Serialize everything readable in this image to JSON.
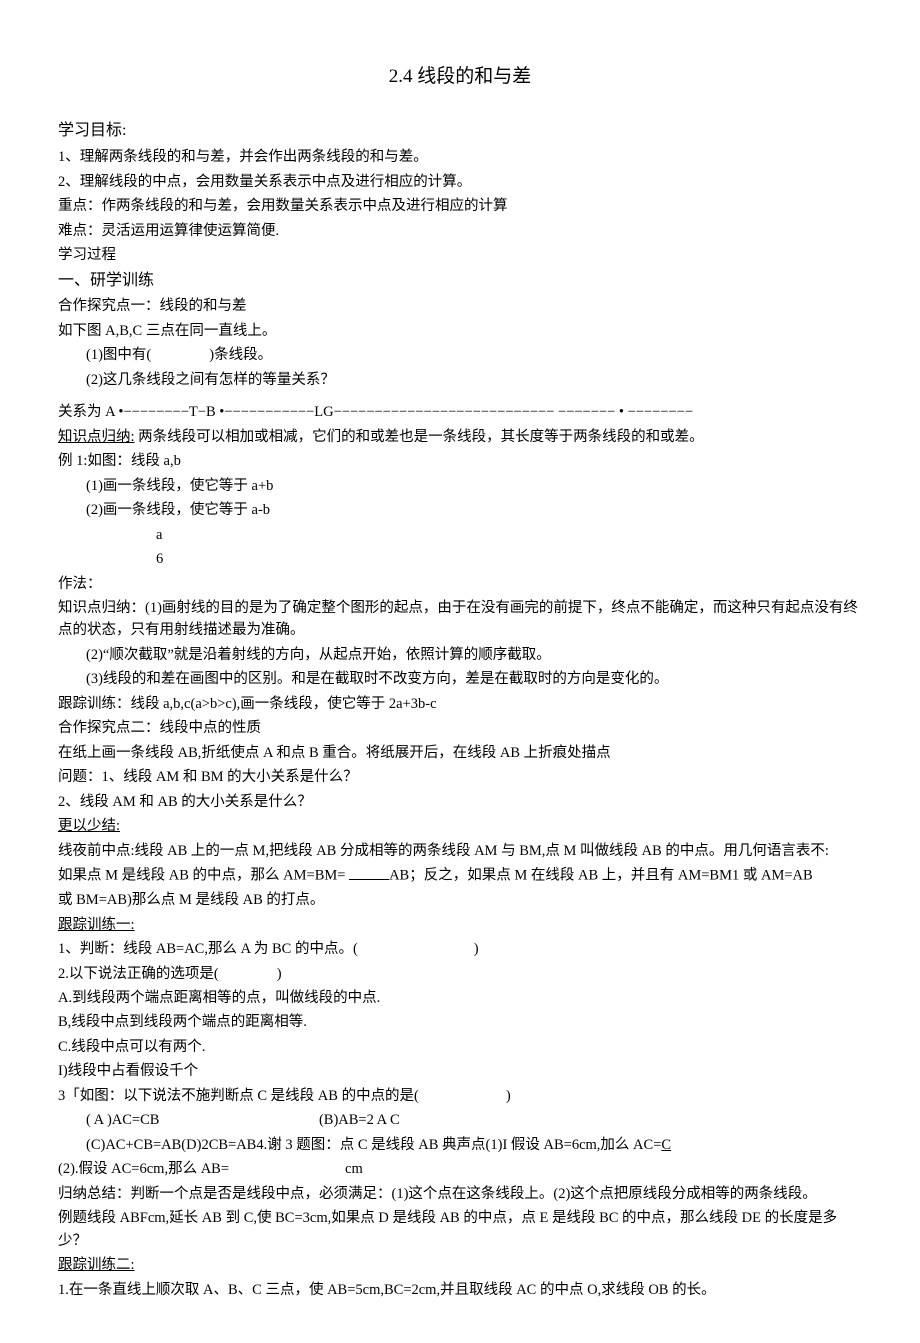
{
  "title": "2.4 线段的和与差",
  "h_goal": "学习目标:",
  "goal1": "1、理解两条线段的和与差，并会作出两条线段的和与差。",
  "goal2": "2、理解线段的中点，会用数量关系表示中点及进行相应的计算。",
  "keypoint": "重点：作两条线段的和与差，会用数量关系表示中点及进行相应的计算",
  "diffpoint": "难点：灵活运用运算律使运算简便.",
  "process": "学习过程",
  "sec1": "一、研学训练",
  "coop1": "合作探究点一：线段的和与差",
  "fig_intro": "如下图 A,B,C 三点在同一直线上。",
  "q1": "(1)图中有(　　　　)条线段。",
  "q2": "(2)这几条线段之间有怎样的等量关系？",
  "relation": "关系为 A •−−−−−−−−T−B •−−−−−−−−−−−LG−−−−−−−−−−−−−−−−−−−−−−−−−−− −−−−−−− •  −−−−−−−−",
  "kn1": "知识点归纳:",
  "kn1_text": " 两条线段可以相加或相减，它们的和或差也是一条线段，其长度等于两条线段的和或差。",
  "ex1": "例 1:如图：线段 a,b",
  "ex1_1": "(1)画一条线段，使它等于 a+b",
  "ex1_2": "(2)画一条线段，使它等于 a-b",
  "ex1_a": "a",
  "ex1_b": "6",
  "method": "作法：",
  "kn2": "知识点归纳：(1)画射线的目的是为了确定整个图形的起点，由于在没有画完的前提下，终点不能确定，而这种只有起点没有终点的状态，只有用射线描述最为准确。",
  "kn2_2": "(2)“顺次截取”就是沿着射线的方向，从起点开始，依照计算的顺序截取。",
  "kn2_3": "(3)线段的和差在画图中的区别。和是在截取时不改变方向，差是在截取时的方向是变化的。",
  "track": "跟踪训练：线段 a,b,c(a>b>c),画一条线段，使它等于 2a+3b-c",
  "coop2": "合作探究点二：线段中点的性质",
  "fold": "在纸上画一条线段 AB,折纸使点 A 和点 B 重合。将纸展开后，在线段 AB 上折痕处描点",
  "pq1": "问题：1、线段 AM 和 BM 的大小关系是什么？",
  "pq2": "2、线段 AM 和 AB 的大小关系是什么？",
  "summary_h": "更以少结:",
  "summary": "线夜前中点:线段 AB 上的一点 M,把线段 AB 分成相等的两条线段 AM 与 BM,点 M 叫做线段 AB 的中点。用几何语言表不:",
  "summary2a": "如果点 M 是线段 AB 的中点，那么 AM=BM= ",
  "summary2b": "AB；反之，如果点 M 在线段 AB 上，并且有 AM=BM1 或 AM=AB",
  "summary3": "或 BM=AB)那么点 M 是线段 AB 的打点。",
  "tt1_h": "跟踪训练一:",
  "tt1_1": "1、判断：线段 AB=AC,那么 A 为 BC 的中点。(　　　　　　　　)",
  "tt1_2": "2.以下说法正确的选项是(　　　　)",
  "tt1_2a": "A.到线段两个端点距离相等的点，叫做线段的中点.",
  "tt1_2b": "B,线段中点到线段两个端点的距离相等.",
  "tt1_2c": "C.线段中点可以有两个.",
  "tt1_2d": "I)线段中占看假设千个",
  "tt1_3": "3「如图：以下说法不施判断点 C 是线段 AB 的中点的是(　　　　　　)",
  "tt1_3ab": "( A )AC=CB　　　　　　　　　　　(B)AB=2 A C",
  "tt1_3cd_a": "(C)AC+CB=AB(D)2CB=AB4.谢 3 题图：点 C 是线段 AB 典声点(1)I 假设 AB=6cm,加么 AC=",
  "tt1_3cd_u": "C",
  "tt1_4": "(2).假设 AC=6cm,那么 AB=　　　　　　　　cm",
  "conclude": "归纳总结：判断一个点是否是线段中点，必须满足：(1)这个点在这条线段上。(2)这个点把原线段分成相等的两条线段。",
  "ex_q": "例题线段 ABFcm,延长 AB 到 C,使 BC=3cm,如果点 D 是线段 AB 的中点，点 E 是线段 BC 的中点，那么线段 DE 的长度是多少？",
  "tt2_h": "跟踪训练二:",
  "tt2_1": "1.在一条直线上顺次取 A、B、C 三点，使 AB=5cm,BC=2cm,并且取线段 AC 的中点 O,求线段 OB 的长。"
}
